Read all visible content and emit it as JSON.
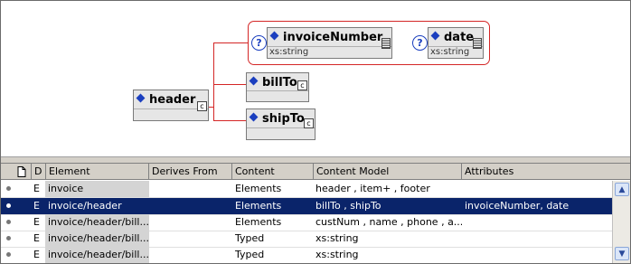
{
  "diagram": {
    "nodes": {
      "invoiceNumber": {
        "label": "invoiceNumber",
        "type": "xs:string"
      },
      "date": {
        "label": "date",
        "type": "xs:string"
      },
      "billTo": {
        "label": "billTo"
      },
      "shipTo": {
        "label": "shipTo"
      },
      "header": {
        "label": "header"
      }
    },
    "question_mark": "?",
    "complex_marker": "c"
  },
  "table": {
    "columns": [
      "D",
      "Element",
      "Derives From",
      "Content",
      "Content Model",
      "Attributes"
    ],
    "rows": [
      {
        "d": "E",
        "element": "invoice",
        "derives": "",
        "content": "Elements",
        "model": "header , item+ , footer",
        "attributes": "",
        "selected": false
      },
      {
        "d": "E",
        "element": "invoice/header",
        "derives": "",
        "content": "Elements",
        "model": "billTo , shipTo",
        "attributes": "invoiceNumber, date",
        "selected": true
      },
      {
        "d": "E",
        "element": "invoice/header/bill...",
        "derives": "",
        "content": "Elements",
        "model": "custNum , name , phone , a...",
        "attributes": "",
        "selected": false
      },
      {
        "d": "E",
        "element": "invoice/header/bill...",
        "derives": "",
        "content": "Typed",
        "model": "xs:string",
        "attributes": "",
        "selected": false
      },
      {
        "d": "E",
        "element": "invoice/header/bill...",
        "derives": "",
        "content": "Typed",
        "model": "xs:string",
        "attributes": "",
        "selected": false
      }
    ]
  },
  "icons": {
    "doc_column": "document-icon",
    "scroll_up": "arrow-up-icon",
    "scroll_down": "arrow-down-icon"
  },
  "colors": {
    "connector": "#d42626",
    "selection": "#0a246a",
    "element_diamond": "#1b3fbf"
  }
}
